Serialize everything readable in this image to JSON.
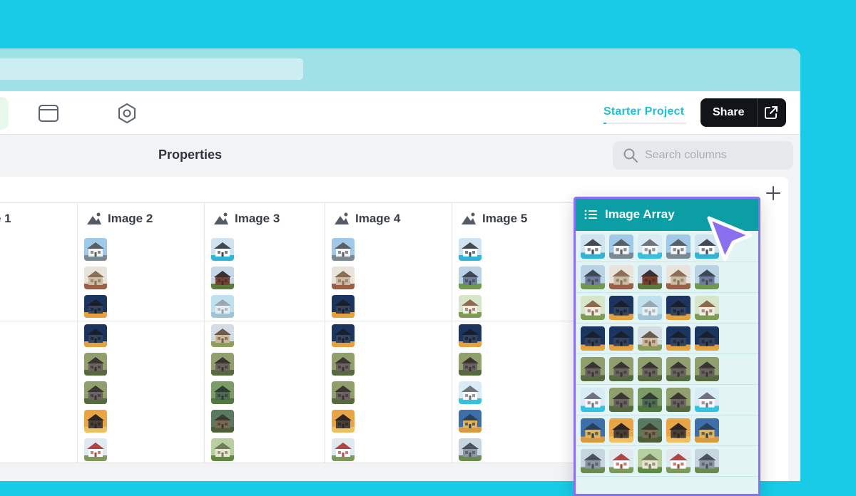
{
  "toolbar": {
    "project_link": "Starter Project",
    "share_label": "Share",
    "icons": [
      "window-icon",
      "hexagon-settings-icon",
      "external-link-icon"
    ]
  },
  "subheader": {
    "title": "Properties",
    "search_placeholder": "Search columns"
  },
  "table": {
    "columns": [
      {
        "label": "e 1"
      },
      {
        "label": "Image 2"
      },
      {
        "label": "Image 3"
      },
      {
        "label": "Image 4"
      },
      {
        "label": "Image 5"
      }
    ],
    "rows": [
      [
        "modern",
        "modern-pool",
        "modern",
        "modern-pool"
      ],
      [
        "interior",
        "brick",
        "interior",
        "colonial"
      ],
      [
        "night",
        "sky",
        "night",
        "cottage"
      ],
      [
        "night",
        "farmhouse",
        "night",
        "night"
      ],
      [
        "grey",
        "grey",
        "grey",
        "grey"
      ],
      [
        "grey",
        "green",
        "grey",
        "pool"
      ],
      [
        "sunset",
        "tree",
        "sunset",
        "sunset-blue"
      ],
      [
        "victorian",
        "garden",
        "victorian",
        "victorian-grey"
      ]
    ]
  },
  "array_panel": {
    "title": "Image Array",
    "rows": [
      [
        "modern-pool",
        "modern",
        "pool",
        "modern",
        "modern-pool"
      ],
      [
        "colonial",
        "interior",
        "brick",
        "interior",
        "colonial"
      ],
      [
        "cottage",
        "night",
        "sky",
        "night",
        "cottage"
      ],
      [
        "night",
        "night",
        "farmhouse",
        "night",
        "night"
      ],
      [
        "grey",
        "grey",
        "grey",
        "grey",
        "grey"
      ],
      [
        "pool",
        "grey",
        "green",
        "grey",
        "pool"
      ],
      [
        "sunset-blue",
        "sunset",
        "tree",
        "sunset",
        "sunset-blue"
      ],
      [
        "victorian-grey",
        "victorian",
        "garden",
        "victorian",
        "victorian-grey"
      ]
    ]
  },
  "colors": {
    "background": "#19cbe6",
    "accent_teal": "#0b9fa5",
    "accent_purple": "#8a70f0",
    "link": "#1fc1d6"
  }
}
